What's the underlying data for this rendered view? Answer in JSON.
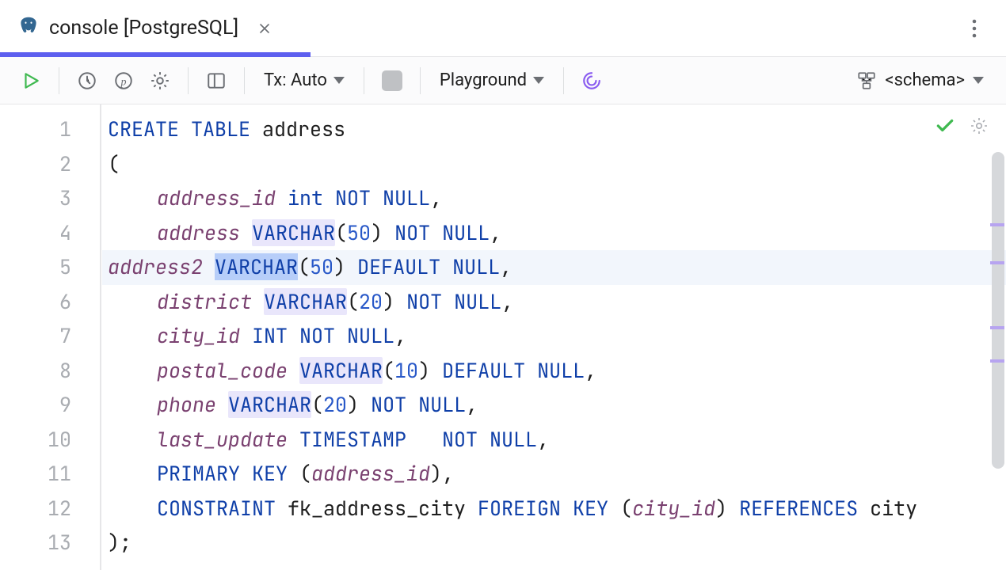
{
  "tab": {
    "title": "console [PostgreSQL]"
  },
  "toolbar": {
    "tx_label": "Tx: Auto",
    "session_label": "Playground",
    "schema_label": "<schema>"
  },
  "code": {
    "lines": [
      [
        {
          "t": "CREATE TABLE",
          "c": "kw"
        },
        {
          "t": " ",
          "c": "id"
        },
        {
          "t": "address",
          "c": "id"
        }
      ],
      [
        {
          "t": "(",
          "c": "id"
        }
      ],
      [
        {
          "t": "address_id ",
          "c": "fn",
          "indent": 1
        },
        {
          "t": "int",
          "c": "kw"
        },
        {
          "t": " ",
          "c": "id"
        },
        {
          "t": "NOT NULL",
          "c": "kw"
        },
        {
          "t": ",",
          "c": "id"
        }
      ],
      [
        {
          "t": "address ",
          "c": "fn",
          "indent": 1
        },
        {
          "t": "VARCHAR",
          "c": "kw",
          "hl": 1
        },
        {
          "t": "(",
          "c": "id"
        },
        {
          "t": "50",
          "c": "num"
        },
        {
          "t": ") ",
          "c": "id"
        },
        {
          "t": "NOT NULL",
          "c": "kw"
        },
        {
          "t": ",",
          "c": "id"
        }
      ],
      [
        {
          "t": "address2 ",
          "c": "fn",
          "indent": 1
        },
        {
          "t": "VARCHAR",
          "c": "kw",
          "sel": 1
        },
        {
          "t": "(",
          "c": "id"
        },
        {
          "t": "50",
          "c": "num"
        },
        {
          "t": ") ",
          "c": "id"
        },
        {
          "t": "DEFAULT NULL",
          "c": "kw"
        },
        {
          "t": ",",
          "c": "id"
        }
      ],
      [
        {
          "t": "district ",
          "c": "fn",
          "indent": 1
        },
        {
          "t": "VARCHAR",
          "c": "kw",
          "hl": 1
        },
        {
          "t": "(",
          "c": "id"
        },
        {
          "t": "20",
          "c": "num"
        },
        {
          "t": ") ",
          "c": "id"
        },
        {
          "t": "NOT NULL",
          "c": "kw"
        },
        {
          "t": ",",
          "c": "id"
        }
      ],
      [
        {
          "t": "city_id ",
          "c": "fn",
          "indent": 1
        },
        {
          "t": "INT",
          "c": "kw"
        },
        {
          "t": " ",
          "c": "id"
        },
        {
          "t": "NOT NULL",
          "c": "kw"
        },
        {
          "t": ",",
          "c": "id"
        }
      ],
      [
        {
          "t": "postal_code ",
          "c": "fn",
          "indent": 1
        },
        {
          "t": "VARCHAR",
          "c": "kw",
          "hl": 1
        },
        {
          "t": "(",
          "c": "id"
        },
        {
          "t": "10",
          "c": "num"
        },
        {
          "t": ") ",
          "c": "id"
        },
        {
          "t": "DEFAULT NULL",
          "c": "kw"
        },
        {
          "t": ",",
          "c": "id"
        }
      ],
      [
        {
          "t": "phone ",
          "c": "fn",
          "indent": 1
        },
        {
          "t": "VARCHAR",
          "c": "kw",
          "hl": 1
        },
        {
          "t": "(",
          "c": "id"
        },
        {
          "t": "20",
          "c": "num"
        },
        {
          "t": ") ",
          "c": "id"
        },
        {
          "t": "NOT NULL",
          "c": "kw"
        },
        {
          "t": ",",
          "c": "id"
        }
      ],
      [
        {
          "t": "last_update ",
          "c": "fn",
          "indent": 1
        },
        {
          "t": "TIMESTAMP",
          "c": "kw"
        },
        {
          "t": "   ",
          "c": "id"
        },
        {
          "t": "NOT NULL",
          "c": "kw"
        },
        {
          "t": ",",
          "c": "id"
        }
      ],
      [
        {
          "t": "PRIMARY KEY",
          "c": "kw",
          "indent": 1
        },
        {
          "t": " (",
          "c": "id"
        },
        {
          "t": "address_id",
          "c": "fn"
        },
        {
          "t": "),",
          "c": "id"
        }
      ],
      [
        {
          "t": "CONSTRAINT",
          "c": "kw",
          "indent": 1
        },
        {
          "t": " fk_address_city ",
          "c": "id"
        },
        {
          "t": "FOREIGN KEY",
          "c": "kw"
        },
        {
          "t": " (",
          "c": "id"
        },
        {
          "t": "city_id",
          "c": "fn"
        },
        {
          "t": ") ",
          "c": "id"
        },
        {
          "t": "REFERENCES",
          "c": "kw"
        },
        {
          "t": " city",
          "c": "id"
        }
      ],
      [
        {
          "t": ");",
          "c": "id"
        }
      ]
    ],
    "active_line": 5,
    "total_lines": 13
  }
}
